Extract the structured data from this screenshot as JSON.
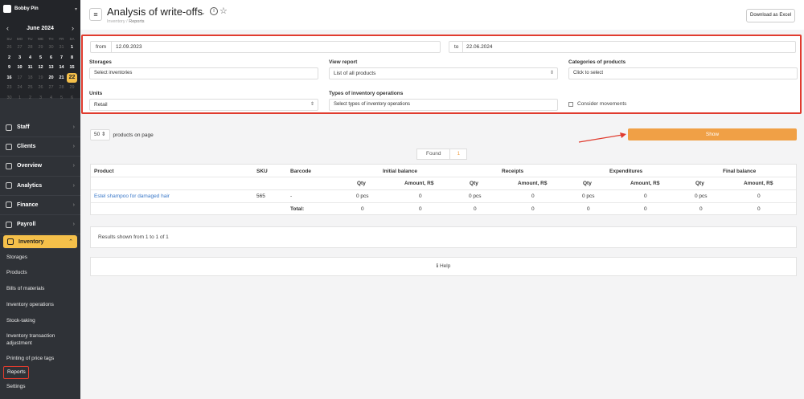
{
  "account": {
    "name": "Bobby Pin"
  },
  "calendar": {
    "month": "June 2024",
    "weekdays": [
      "SU",
      "MO",
      "TU",
      "WE",
      "TH",
      "FR",
      "SA"
    ],
    "rows": [
      [
        "26",
        "27",
        "28",
        "29",
        "30",
        "31",
        "1"
      ],
      [
        "2",
        "3",
        "4",
        "5",
        "6",
        "7",
        "8"
      ],
      [
        "9",
        "10",
        "11",
        "12",
        "13",
        "14",
        "15"
      ],
      [
        "16",
        "17",
        "18",
        "19",
        "20",
        "21",
        "22"
      ],
      [
        "23",
        "24",
        "25",
        "26",
        "27",
        "28",
        "29"
      ],
      [
        "30",
        "1",
        "2",
        "3",
        "4",
        "5",
        "6"
      ]
    ],
    "today": "22"
  },
  "nav": {
    "staff": "Staff",
    "clients": "Clients",
    "overview": "Overview",
    "analytics": "Analytics",
    "finance": "Finance",
    "payroll": "Payroll",
    "inventory": "Inventory",
    "sub": {
      "storages": "Storages",
      "products": "Products",
      "bom": "Bills of materials",
      "ops": "Inventory operations",
      "stocktaking": "Stock-taking",
      "adjustment": "Inventory transaction adjustment",
      "printing": "Printing of price tags",
      "reports": "Reports",
      "settings": "Settings"
    }
  },
  "header": {
    "title": "Analysis of write-offs",
    "breadcrumb": [
      "Inventory",
      "Reports"
    ],
    "excel_label": "Download as Excel"
  },
  "filters": {
    "from_label": "from",
    "from_value": "12.09.2023",
    "to_label": "to",
    "to_value": "22.06.2024",
    "storages_label": "Storages",
    "storages_placeholder": "Select inventories",
    "view_label": "View report",
    "view_value": "List of all products",
    "categories_label": "Categories of products",
    "categories_placeholder": "Click to select",
    "units_label": "Units",
    "units_value": "Retail",
    "types_label": "Types of inventory operations",
    "types_placeholder": "Select types of inventory operations",
    "consider_label": "Consider movements"
  },
  "controls": {
    "per_page": "50",
    "per_page_label": "products on page",
    "show_label": "Show",
    "found_label": "Found",
    "found_count": "1"
  },
  "table": {
    "headers": {
      "product": "Product",
      "sku": "SKU",
      "barcode": "Barcode",
      "initial": "Initial balance",
      "receipts": "Receipts",
      "expenditures": "Expenditures",
      "final": "Final balance"
    },
    "sub": {
      "qty": "Qty",
      "amount": "Amount, R$"
    },
    "row": {
      "product": "Estel shampoo for damaged hair",
      "sku": "565",
      "barcode": "-",
      "values": [
        "0 pcs",
        "0",
        "0 pcs",
        "0",
        "0 pcs",
        "0",
        "0 pcs",
        "0"
      ]
    },
    "total": {
      "label": "Total:",
      "values": [
        "0",
        "0",
        "0",
        "0",
        "0",
        "0",
        "0",
        "0"
      ]
    }
  },
  "results_text": "Results shown from 1 to 1 of 1",
  "help_label": "Help",
  "colors": {
    "accent": "#f5c04a",
    "show_button": "#f0a046",
    "highlight": "#e03b2e",
    "sidebar": "#2f3237"
  }
}
